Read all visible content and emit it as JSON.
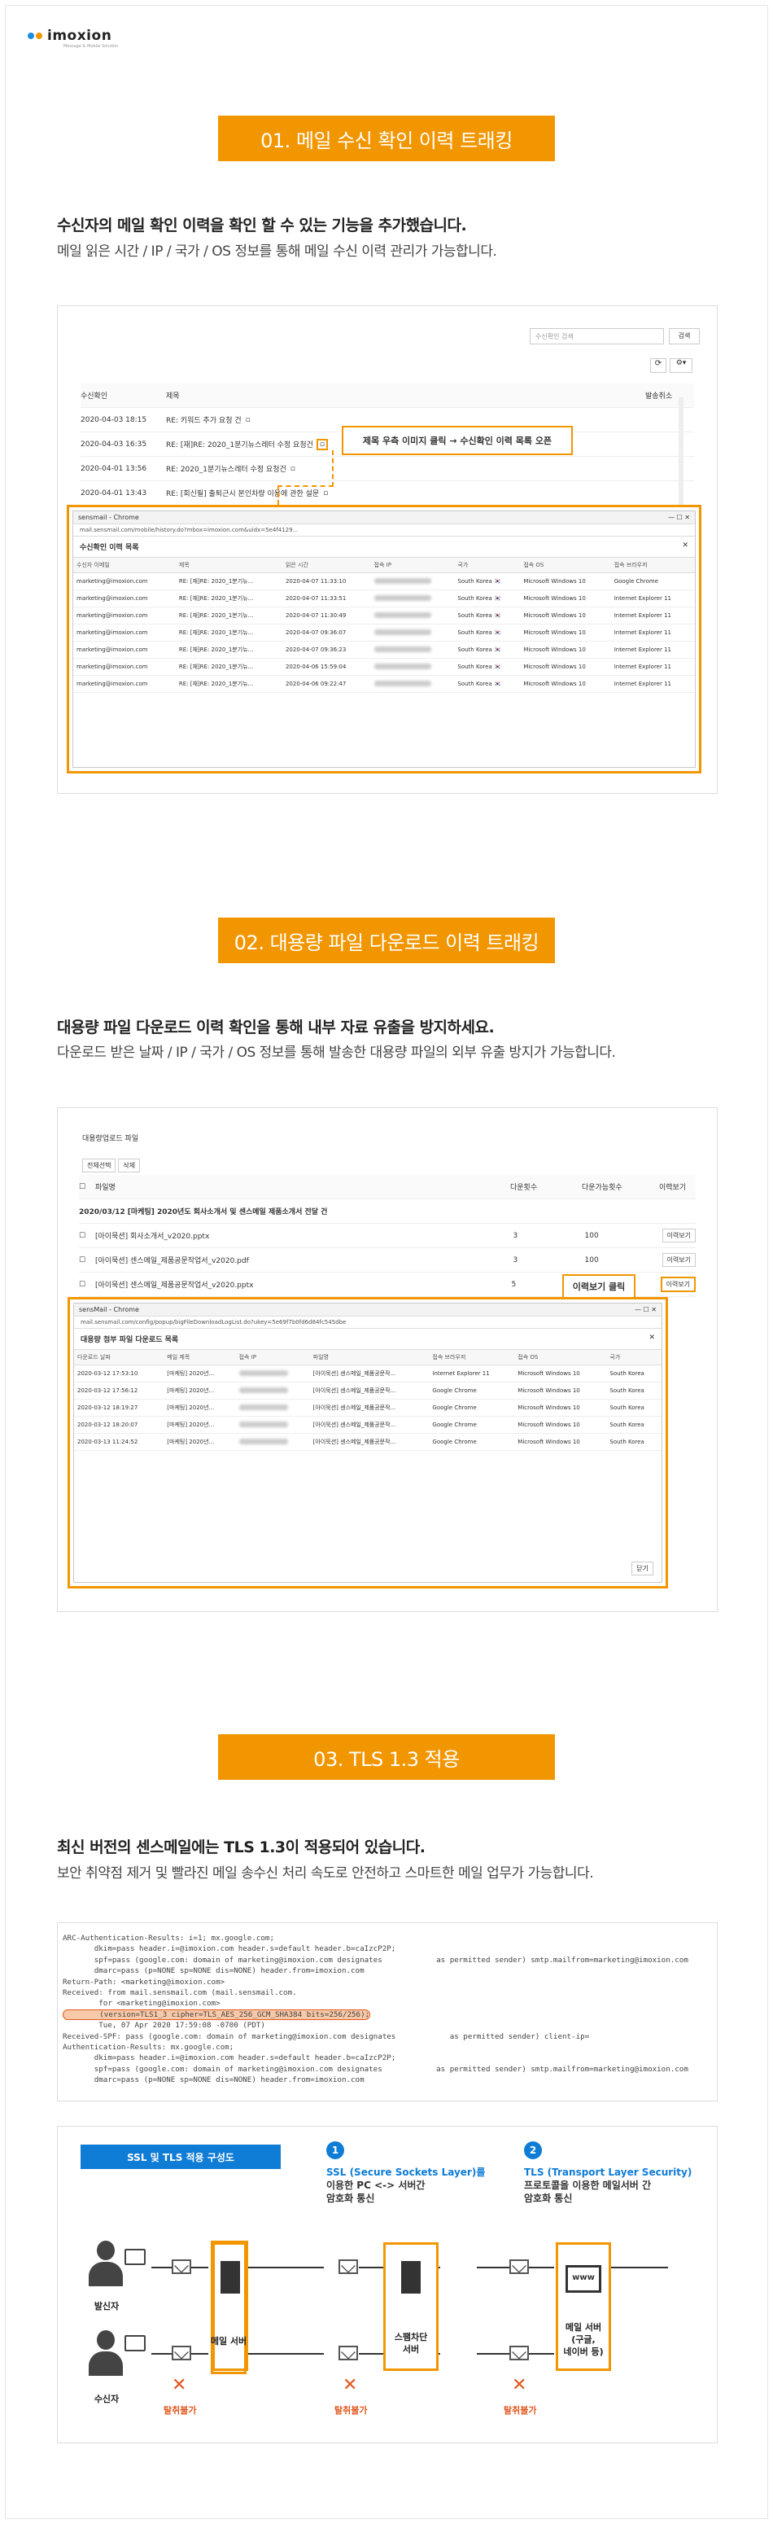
{
  "brand": {
    "name": "imoxion",
    "tagline": "Message & Mobile Solution",
    "dot_colors": [
      "#1a8fe0",
      "#f29600"
    ]
  },
  "accent": "#f29600",
  "sections": [
    {
      "pill": "01. 메일 수신 확인 이력 트래킹",
      "heading": "수신자의 메일 확인 이력을 확인 할 수 있는 기능을 추가했습니다.",
      "sub": "메일 읽은 시간 / IP / 국가 / OS 정보를 통해 메일 수신 이력 관리가 가능합니다."
    },
    {
      "pill": "02. 대용량 파일 다운로드 이력 트래킹",
      "heading": "대용량 파일 다운로드 이력 확인을 통해 내부 자료 유출을 방지하세요.",
      "sub": "다운로드 받은 날짜 / IP / 국가 / OS 정보를 통해 발송한 대용량 파일의 외부 유출 방지가 가능합니다."
    },
    {
      "pill": "03. TLS 1.3 적용",
      "heading": "최신 버전의 센스메일에는 TLS 1.3이 적용되어 있습니다.",
      "sub": "보안 취약점 제거 및 빨라진 메일 송수신 처리 속도로 안전하고 스마트한 메일 업무가 가능합니다."
    }
  ],
  "shot1": {
    "search_placeholder": "수신확인 검색",
    "search_btn": "검색",
    "headers": {
      "status": "수신확인",
      "subject": "제목",
      "cancel": "발송취소"
    },
    "rows": [
      {
        "date": "2020-04-03 18:15",
        "subject": "RE: 키워드 추가 요청 건"
      },
      {
        "date": "2020-04-03 16:35",
        "subject": "RE: [재]RE: 2020_1분기뉴스레터 수정 요청건"
      },
      {
        "date": "2020-04-01 13:56",
        "subject": "RE: 2020_1분기뉴스레터 수정 요청건"
      },
      {
        "date": "2020-04-01 13:43",
        "subject": "RE: [회신필] 출퇴근시 본인차량 이용에 관한 설문"
      }
    ],
    "callout": "제목 우측 이미지 클릭 → 수신확인 이력 목록 오픈",
    "popup": {
      "window": "sensmail - Chrome",
      "url": "mail.sensmail.com/mobile/history.do?mbox=imoxion.com&uidx=5e4f4129...",
      "title": "수신확인 이력 목록",
      "cols": [
        "수신자 이메일",
        "제목",
        "읽은 시간",
        "접속 IP",
        "국가",
        "접속 OS",
        "접속 브라우저"
      ],
      "rows": [
        [
          "marketing@imoxion.com",
          "RE: [재]RE: 2020_1분기뉴...",
          "2020-04-07 11:33:10",
          "South Korea",
          "Microsoft Windows 10",
          "Google Chrome"
        ],
        [
          "marketing@imoxion.com",
          "RE: [재]RE: 2020_1분기뉴...",
          "2020-04-07 11:33:51",
          "South Korea",
          "Microsoft Windows 10",
          "Internet Explorer 11"
        ],
        [
          "marketing@imoxion.com",
          "RE: [재]RE: 2020_1분기뉴...",
          "2020-04-07 11:30:49",
          "South Korea",
          "Microsoft Windows 10",
          "Internet Explorer 11"
        ],
        [
          "marketing@imoxion.com",
          "RE: [재]RE: 2020_1분기뉴...",
          "2020-04-07 09:36:07",
          "South Korea",
          "Microsoft Windows 10",
          "Internet Explorer 11"
        ],
        [
          "marketing@imoxion.com",
          "RE: [재]RE: 2020_1분기뉴...",
          "2020-04-07 09:36:23",
          "South Korea",
          "Microsoft Windows 10",
          "Internet Explorer 11"
        ],
        [
          "marketing@imoxion.com",
          "RE: [재]RE: 2020_1분기뉴...",
          "2020-04-06 15:59:04",
          "South Korea",
          "Microsoft Windows 10",
          "Internet Explorer 11"
        ],
        [
          "marketing@imoxion.com",
          "RE: [재]RE: 2020_1분기뉴...",
          "2020-04-06 09:22:47",
          "South Korea",
          "Microsoft Windows 10",
          "Internet Explorer 11"
        ]
      ]
    }
  },
  "shot2": {
    "title": "대용량업로드 파일",
    "tabs": [
      "전체선택",
      "삭제"
    ],
    "headers": {
      "file": "파일명",
      "dl": "다운횟수",
      "limit": "다운가능횟수",
      "hist": "이력보기"
    },
    "group": "2020/03/12 [마케팅] 2020년도 회사소개서 및 센스메일 제품소개서 전달 건",
    "rows": [
      {
        "file": "[아이묵션] 회사소개서_v2020.pptx",
        "dl": "3",
        "limit": "100",
        "btn": "이력보기"
      },
      {
        "file": "[아이묵션] 센스메일_제품공문작업서_v2020.pdf",
        "dl": "3",
        "limit": "100",
        "btn": "이력보기"
      },
      {
        "file": "[아이묵션] 센스메일_제품공문작업서_v2020.pptx",
        "dl": "5",
        "limit": "",
        "btn": "이력보기"
      }
    ],
    "callout": "이력보기 클릭",
    "popup": {
      "window": "sensMail - Chrome",
      "url": "mail.sensmail.com/config/popup/bigFileDownloadLogList.do?ukey=5e69f7b0fd6d84fc545dbe",
      "title": "대용량 첨부 파일 다운로드 목록",
      "cols": [
        "다운로드 날짜",
        "메일 제목",
        "접속 IP",
        "파일명",
        "접속 브라우저",
        "접속 OS",
        "국가"
      ],
      "rows": [
        [
          "2020-03-12 17:53:10",
          "[마케팅] 2020년...",
          "[아이묵션] 센스메일_제품공문작...",
          "Internet Explorer 11",
          "Microsoft Windows 10",
          "South Korea"
        ],
        [
          "2020-03-12 17:56:12",
          "[마케팅] 2020년...",
          "[아이묵션] 센스메일_제품공문작...",
          "Google Chrome",
          "Microsoft Windows 10",
          "South Korea"
        ],
        [
          "2020-03-12 18:19:27",
          "[마케팅] 2020년...",
          "[아이묵션] 센스메일_제품공문작...",
          "Google Chrome",
          "Microsoft Windows 10",
          "South Korea"
        ],
        [
          "2020-03-12 18:20:07",
          "[마케팅] 2020년...",
          "[아이묵션] 센스메일_제품공문작...",
          "Google Chrome",
          "Microsoft Windows 10",
          "South Korea"
        ],
        [
          "2020-03-13 11:24:52",
          "[마케팅] 2020년...",
          "[아이묵션] 센스메일_제품공문작...",
          "Google Chrome",
          "Microsoft Windows 10",
          "South Korea"
        ]
      ],
      "close": "닫기"
    }
  },
  "shot3": {
    "lines": [
      "ARC-Authentication-Results: i=1; mx.google.com;",
      "       dkim=pass header.i=@imoxion.com header.s=default header.b=caIzcP2P;",
      "       spf=pass (google.com: domain of marketing@imoxion.com designates            as permitted sender) smtp.mailfrom=marketing@imoxion.com",
      "       dmarc=pass (p=NONE sp=NONE dis=NONE) header.from=imoxion.com",
      "Return-Path: <marketing@imoxion.com>",
      "Received: from mail.sensmail.com (mail.sensmail.com.",
      "",
      "        for <marketing@imoxion.com>",
      "        (version=TLS1_3 cipher=TLS_AES_256_GCM_SHA384 bits=256/256);",
      "        Tue, 07 Apr 2020 17:59:08 -0700 (PDT)",
      "Received-SPF: pass (google.com: domain of marketing@imoxion.com designates            as permitted sender) client-ip=",
      "Authentication-Results: mx.google.com;",
      "       dkim=pass header.i=@imoxion.com header.s=default header.b=caIzcP2P;",
      "       spf=pass (google.com: domain of marketing@imoxion.com designates            as permitted sender) smtp.mailfrom=marketing@imoxion.com",
      "       dmarc=pass (p=NONE sp=NONE dis=NONE) header.from=imoxion.com"
    ]
  },
  "diagram": {
    "badge": "SSL 및 TLS 적용 구성도",
    "n1": "1",
    "ssl_title": "SSL (Secure Sockets Layer)를",
    "ssl_desc1": "이용한 PC <-> 서버간",
    "ssl_desc2": "암호화 통신",
    "n2": "2",
    "tls_title": "TLS (Transport Layer Security)",
    "tls_desc1": "프로토콜을 이용한 메일서버 간",
    "tls_desc2": "암호화 통신",
    "sender": "발신자",
    "receiver": "수신자",
    "mail_server": "메일 서버",
    "spam_server1": "스팸차단",
    "spam_server2": "서버",
    "ext_server1": "메일 서버",
    "ext_server2": "(구글,",
    "ext_server3": "네이버 등)",
    "www": "www",
    "blocked": "탈취불가"
  }
}
